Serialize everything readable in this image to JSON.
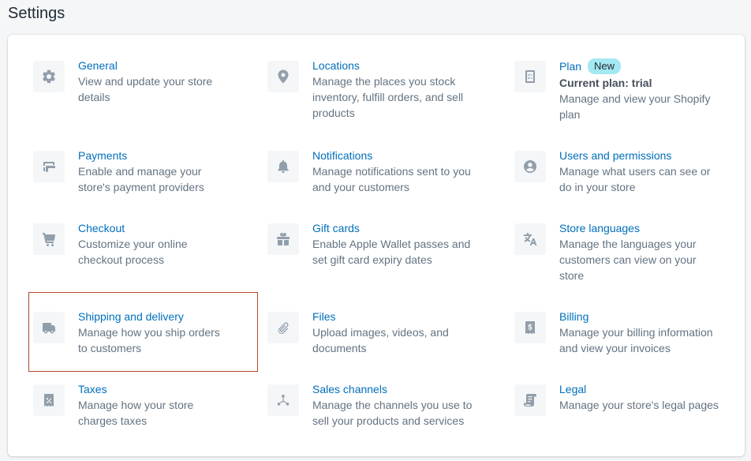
{
  "page": {
    "title": "Settings"
  },
  "settings": [
    {
      "title": "General",
      "description": "View and update your store details",
      "icon": "gear-icon"
    },
    {
      "title": "Locations",
      "description": "Manage the places you stock inventory, fulfill orders, and sell products",
      "icon": "location-pin-icon"
    },
    {
      "title": "Plan",
      "badge": "New",
      "subtitle": "Current plan: trial",
      "description": "Manage and view your Shopify plan",
      "icon": "plan-document-icon"
    },
    {
      "title": "Payments",
      "description": "Enable and manage your store's payment providers",
      "icon": "payments-icon"
    },
    {
      "title": "Notifications",
      "description": "Manage notifications sent to you and your customers",
      "icon": "bell-icon"
    },
    {
      "title": "Users and permissions",
      "description": "Manage what users can see or do in your store",
      "icon": "user-circle-icon"
    },
    {
      "title": "Checkout",
      "description": "Customize your online checkout process",
      "icon": "cart-icon"
    },
    {
      "title": "Gift cards",
      "description": "Enable Apple Wallet passes and set gift card expiry dates",
      "icon": "gift-icon"
    },
    {
      "title": "Store languages",
      "description": "Manage the languages your customers can view on your store",
      "icon": "translate-icon"
    },
    {
      "title": "Shipping and delivery",
      "description": "Manage how you ship orders to customers",
      "icon": "truck-icon"
    },
    {
      "title": "Files",
      "description": "Upload images, videos, and documents",
      "icon": "paperclip-icon"
    },
    {
      "title": "Billing",
      "description": "Manage your billing information and view your invoices",
      "icon": "invoice-icon"
    },
    {
      "title": "Taxes",
      "description": "Manage how your store charges taxes",
      "icon": "tax-icon"
    },
    {
      "title": "Sales channels",
      "description": "Manage the channels you use to sell your products and services",
      "icon": "channels-icon"
    },
    {
      "title": "Legal",
      "description": "Manage your store's legal pages",
      "icon": "legal-scroll-icon"
    }
  ],
  "colors": {
    "link": "#006fbb",
    "text_subdued": "#637381",
    "icon": "#919eab",
    "badge": "#a4e8f2",
    "highlight": "#b5472c"
  }
}
